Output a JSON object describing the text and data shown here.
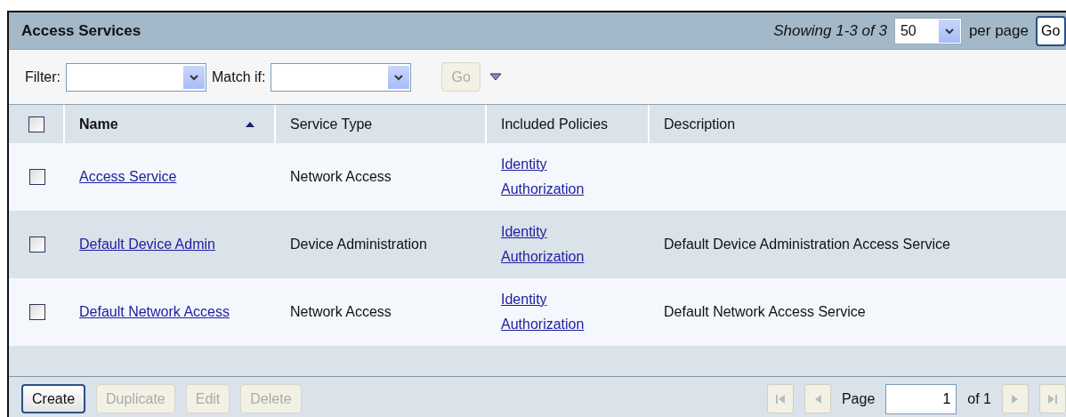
{
  "panel": {
    "title": "Access Services",
    "showing": "Showing 1-3 of 3",
    "per_page_value": "50",
    "per_page_label": "per page",
    "per_page_go": "Go"
  },
  "filter": {
    "filter_label": "Filter:",
    "match_label": "Match if:",
    "go": {
      "label": "Go",
      "disabled": true
    }
  },
  "table": {
    "select_all_checked": false,
    "columns": [
      {
        "label": "Name",
        "sorted": true
      },
      {
        "label": "Service Type",
        "sorted": false
      },
      {
        "label": "Included Policies",
        "sorted": false
      },
      {
        "label": "Description",
        "sorted": false
      }
    ],
    "rows": [
      {
        "checked": false,
        "name": "Access Service",
        "service_type": "Network Access",
        "policies": [
          "Identity",
          "Authorization"
        ]
      },
      {
        "checked": false,
        "name": "Default Device Admin",
        "service_type": "Device Administration",
        "policies": [
          "Identity",
          "Authorization"
        ],
        "description": "Default Device Administration Access Service"
      },
      {
        "checked": false,
        "name": "Default Network Access",
        "service_type": "Network Access",
        "policies": [
          "Identity",
          "Authorization"
        ],
        "description": "Default Network Access Service"
      }
    ]
  },
  "actions": [
    {
      "label": "Create",
      "disabled": false
    },
    {
      "label": "Duplicate",
      "disabled": true
    },
    {
      "label": "Edit",
      "disabled": true
    },
    {
      "label": "Delete",
      "disabled": true
    }
  ],
  "pagination": {
    "page_label": "Page",
    "page_value": "1",
    "of_label": "of 1",
    "first_disabled": true,
    "prev_disabled": true,
    "next_disabled": true,
    "last_disabled": true
  }
}
